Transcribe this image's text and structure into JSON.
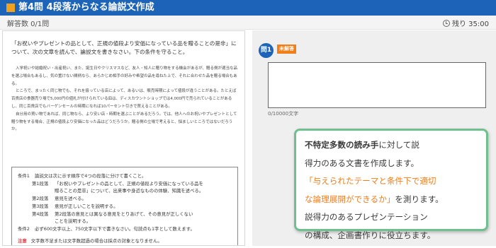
{
  "header": {
    "title": "第4問 4段落からなる論説文作成"
  },
  "status": {
    "answered_label": "解答数 0/1問",
    "remaining_label": "残り 35:00"
  },
  "problem": {
    "prompt": "「お祝いやプレゼントの品として、正規の値段より安価になっている品を贈ることの是非」について、次の文章を読んで、論説文を書きなさい。下の条件を守ること。",
    "passage": [
      "入学祝いや結婚祝い・出産祝い、また、誕生日やクリスマスなど、友人・知人に贈り物をする機会があるが、贈る側が適当な品を選ぶ場合もあるし、気の置けない間柄なら、あらかじめ相手の好みや希望の品を尋ねた上で、それに合わせた品を贈る場合もある。",
      "ところで、まったく同じ物でも、それを扱っている店によって、あるいは、販売時期によって値段が違うことがある。たとえば百貨店の食器売り場で5,000円の値札が付けられている皿は、ディスカウントショップでは4,000円で売られていることがあるし、同じ百貨店でもバーゲンセールの時期になれば10パーセント引きで買えることがある。",
      "自分用の買い物であれば、同じ物なら、より安い店・時期を選ぶことがあるだろう。では、他人へのお祝いやプレゼントとして贈り物をする場合、正規の値段より安価になった品はどうだろうか。贈る側の立場で考えると、悩ましいところではないだろうか。"
    ],
    "conditions": {
      "cond1_label": "条件1",
      "cond1_text": "論説文は次に示す順序で4つの段落に分けて書くこと。",
      "para1_label": "第1段落",
      "para1_text": "「お祝いやプレゼントの品として、正規の値段より安価になっている品を",
      "para1_text2": "贈ることの是非」について、出来事や身近なものの体験、知識を述べる。",
      "para2_label": "第2段落",
      "para2_text": "意見を述べる。",
      "para3_label": "第3段落",
      "para3_text": "意見が正しいことを説明する。",
      "para4_label": "第4段落",
      "para4_text": "第2段落の意見とは異なる意見をとりあげて、その意見が正しくない",
      "para4_text2": "ことを説明する。",
      "cond2_label": "条件2",
      "cond2_text": "必ず600文字以上、750文字以下で書きなさい。句読点も1字として数えます。",
      "notice_label": "注意",
      "notice_text": "文字数不足または文字数超過の場合は採点の対象となりません。"
    }
  },
  "answer": {
    "question_badge": "問1",
    "status_tag": "未解答",
    "char_count": "0/10000文字"
  },
  "callout": {
    "part1_bold": "不特定多数の読み手",
    "part1_rest": "に対して説",
    "part2": "得力のある文書を作成します。",
    "part3_hl": "「与えられたテーマと条件下で適切",
    "part4_hl": "な論理展開ができるか」",
    "part4_rest": "を測ります。",
    "part5": "説得力のあるプレゼンテーション",
    "part6": "の構成、企画書作りに役立ちます。"
  },
  "colors": {
    "header_blue": "#1d64b8",
    "accent_orange": "#f07e1a",
    "callout_border": "#6fbf8f",
    "notice_red": "#d9434b"
  }
}
